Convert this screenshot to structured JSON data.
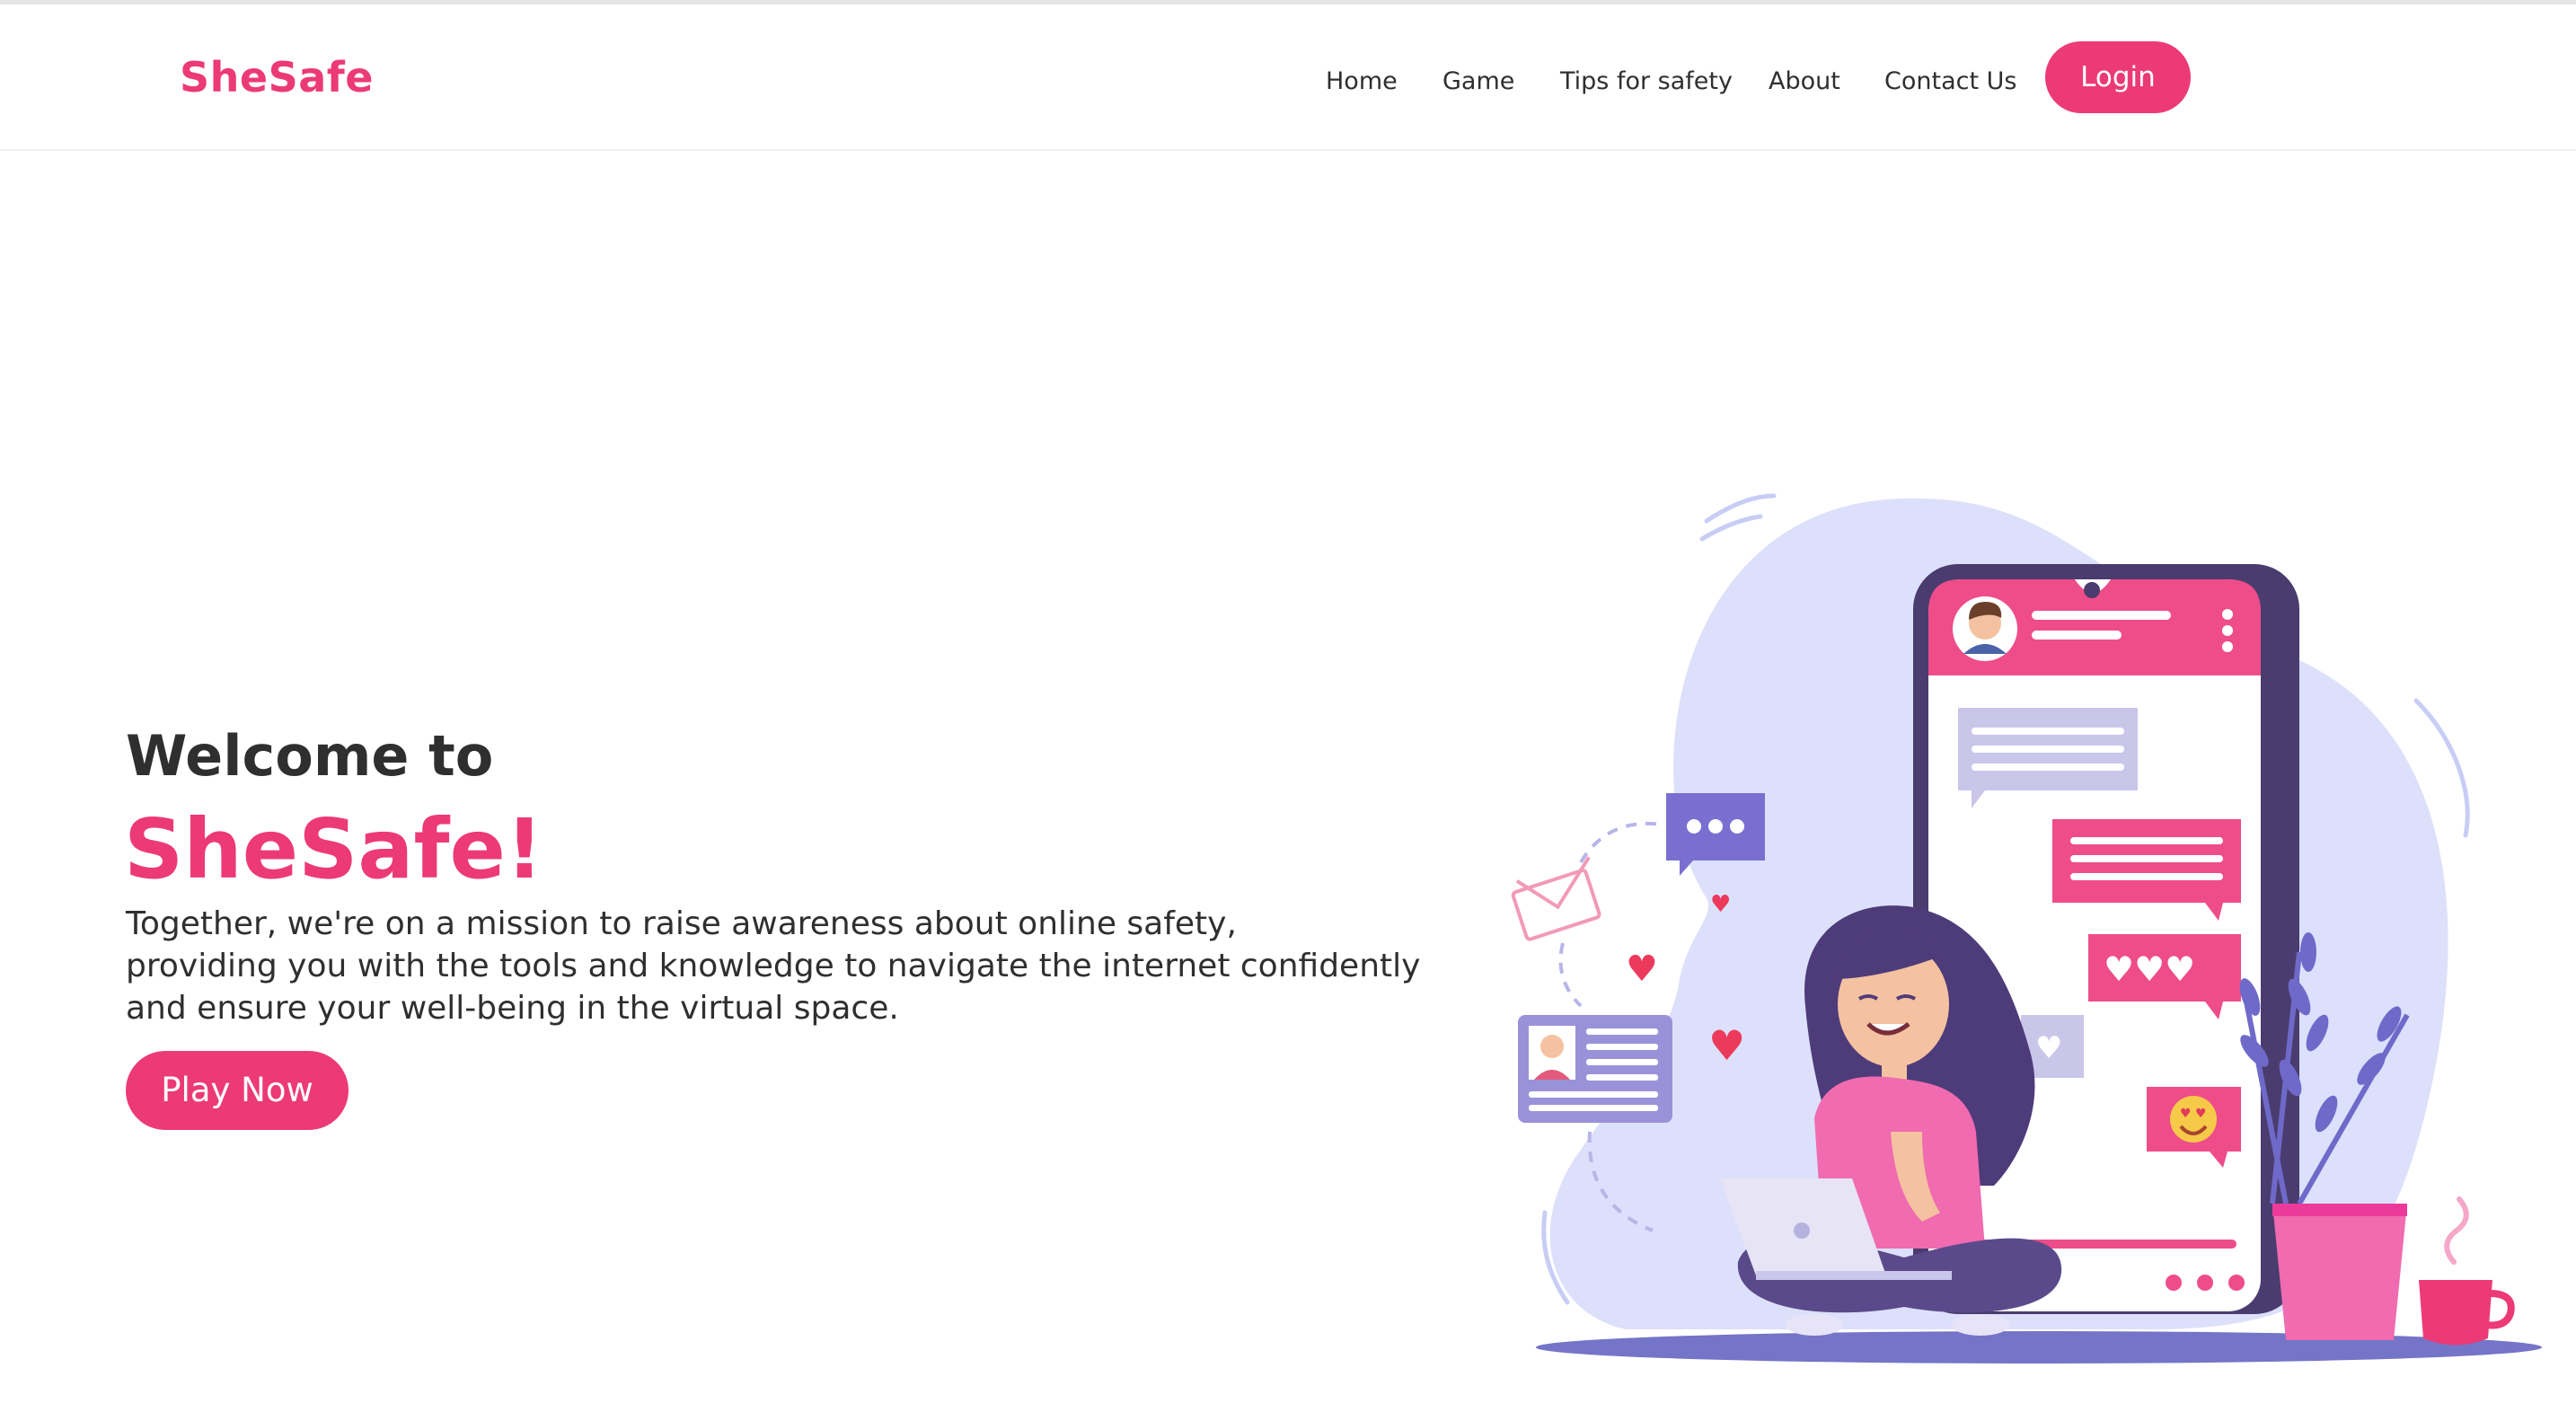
{
  "navbar": {
    "brand": "SheSafe",
    "links": [
      "Home",
      "Game",
      "Tips for safety",
      "About",
      "Contact Us"
    ],
    "login_label": "Login"
  },
  "hero": {
    "welcome": "Welcome to",
    "brand": "SheSafe!",
    "description_lines": [
      "Together, we're on a mission to raise awareness about online safety,",
      "providing you with the tools and knowledge to navigate the internet confidently",
      "and ensure your well-being in the virtual space."
    ],
    "cta_label": "Play Now"
  },
  "colors": {
    "accent": "#ec3a76",
    "text": "#2f2f2f",
    "blob": "#dde0fa",
    "purple": "#5b4a8b",
    "lavender": "#8e86d6"
  },
  "illustration": {
    "icons": [
      "woman-with-laptop",
      "smartphone",
      "chat-bubble-icon",
      "heart-icon",
      "mail-icon",
      "profile-card-icon",
      "plant",
      "coffee-cup-icon"
    ]
  }
}
